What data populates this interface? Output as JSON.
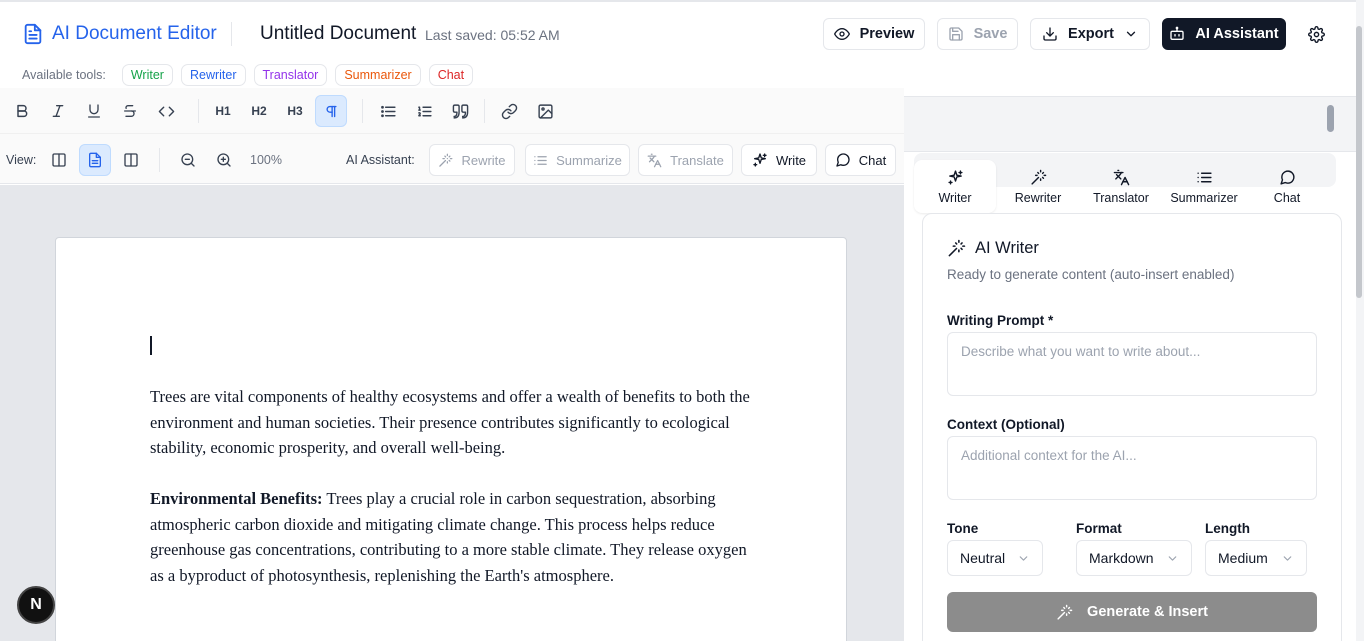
{
  "header": {
    "app_title": "AI Document Editor",
    "doc_title": "Untitled Document",
    "last_saved": "Last saved: 05:52 AM",
    "preview_label": "Preview",
    "save_label": "Save",
    "export_label": "Export",
    "ai_assistant_label": "AI Assistant"
  },
  "tools": {
    "label": "Available tools:",
    "chips": [
      {
        "label": "Writer",
        "color": "#16a34a"
      },
      {
        "label": "Rewriter",
        "color": "#2563eb"
      },
      {
        "label": "Translator",
        "color": "#9333ea"
      },
      {
        "label": "Summarizer",
        "color": "#ea580c"
      },
      {
        "label": "Chat",
        "color": "#dc2626"
      }
    ]
  },
  "toolbar": {
    "h1": "H1",
    "h2": "H2",
    "h3": "H3",
    "view_label": "View:",
    "zoom": "100%",
    "ai_label": "AI Assistant:",
    "rewrite": "Rewrite",
    "summarize": "Summarize",
    "translate": "Translate",
    "write": "Write",
    "chat": "Chat"
  },
  "document": {
    "p1": "Trees are vital components of healthy ecosystems and offer a wealth of benefits to both the environment and human societies. Their presence contributes significantly to ecological stability, economic prosperity, and overall well-being.",
    "p2_bold": "Environmental Benefits:",
    "p2": " Trees play a crucial role in carbon sequestration, absorbing atmospheric carbon dioxide and mitigating climate change. This process helps reduce greenhouse gas concentrations, contributing to a more stable climate. They release oxygen as a byproduct of photosynthesis, replenishing the Earth's atmosphere."
  },
  "badge": "N",
  "panel": {
    "tabs": [
      "Writer",
      "Rewriter",
      "Translator",
      "Summarizer",
      "Chat"
    ],
    "title": "AI Writer",
    "subtitle": "Ready to generate content (auto-insert enabled)",
    "prompt_label": "Writing Prompt *",
    "prompt_placeholder": "Describe what you want to write about...",
    "context_label": "Context (Optional)",
    "context_placeholder": "Additional context for the AI...",
    "tone_label": "Tone",
    "tone_value": "Neutral",
    "format_label": "Format",
    "format_value": "Markdown",
    "length_label": "Length",
    "length_value": "Medium",
    "generate_label": "Generate & Insert"
  }
}
